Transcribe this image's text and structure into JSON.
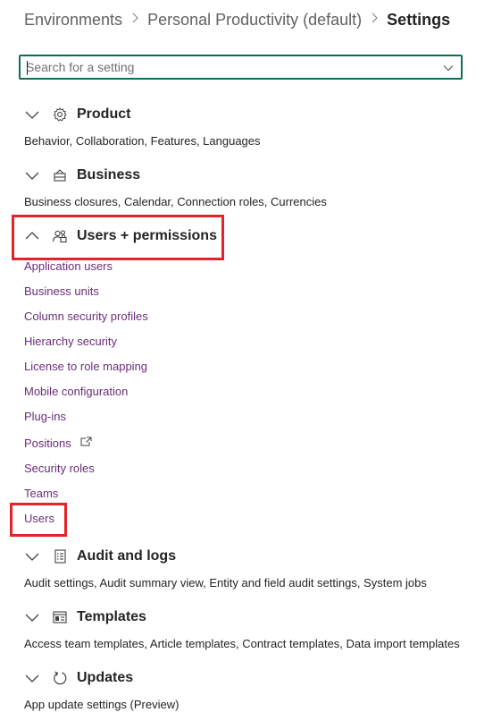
{
  "breadcrumb": {
    "items": [
      "Environments",
      "Personal Productivity (default)"
    ],
    "current": "Settings"
  },
  "search": {
    "placeholder": "Search for a setting",
    "value": ""
  },
  "sections": [
    {
      "title": "Product",
      "icon": "gear-icon",
      "expanded": false,
      "summary": "Behavior, Collaboration, Features, Languages"
    },
    {
      "title": "Business",
      "icon": "business-icon",
      "expanded": false,
      "summary": "Business closures, Calendar, Connection roles, Currencies"
    },
    {
      "title": "Users + permissions",
      "icon": "people-icon",
      "expanded": true,
      "items": [
        "Application users",
        "Business units",
        "Column security profiles",
        "Hierarchy security",
        "License to role mapping",
        "Mobile configuration",
        "Plug-ins",
        "Positions",
        "Security roles",
        "Teams",
        "Users"
      ]
    },
    {
      "title": "Audit and logs",
      "icon": "checklist-icon",
      "expanded": false,
      "summary": "Audit settings, Audit summary view, Entity and field audit settings, System jobs"
    },
    {
      "title": "Templates",
      "icon": "template-icon",
      "expanded": false,
      "summary": "Access team templates, Article templates, Contract templates, Data import templates"
    },
    {
      "title": "Updates",
      "icon": "refresh-icon",
      "expanded": false,
      "summary": "App update settings (Preview)"
    }
  ],
  "colors": {
    "accent": "#0f6c5a",
    "link": "#6b2d7a",
    "highlight": "#e3242b"
  }
}
